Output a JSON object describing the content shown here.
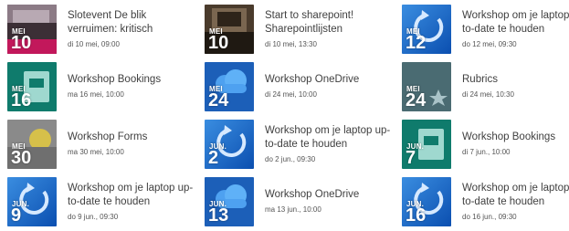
{
  "events": [
    {
      "title": "Slotevent De blik verruimen: kritisch",
      "date": "di 10 mei, 09:00",
      "month": "MEI",
      "day": "10",
      "theme": "photo",
      "icon": "photo-thumbnail"
    },
    {
      "title": "Start to sharepoint! Sharepointlijsten",
      "date": "di 10 mei, 13:30",
      "month": "MEI",
      "day": "10",
      "theme": "photo2",
      "icon": "photo-thumbnail"
    },
    {
      "title": "Workshop om je laptop up-to-date te houden",
      "date": "do 12 mei, 09:30",
      "month": "MEI",
      "day": "12",
      "theme": "blue",
      "icon": "refresh-icon"
    },
    {
      "title": "Workshop Bookings",
      "date": "ma 16 mei, 10:00",
      "month": "MEI",
      "day": "16",
      "theme": "teal",
      "icon": "bookings-icon"
    },
    {
      "title": "Workshop OneDrive",
      "date": "di 24 mei, 10:00",
      "month": "MEI",
      "day": "24",
      "theme": "cloud",
      "icon": "cloud-icon"
    },
    {
      "title": "Rubrics",
      "date": "di 24 mei, 10:30",
      "month": "MEI",
      "day": "24",
      "theme": "grey",
      "icon": "star-icon"
    },
    {
      "title": "Workshop Forms",
      "date": "ma 30 mei, 10:00",
      "month": "MEI",
      "day": "30",
      "theme": "forms",
      "icon": "forms-icon"
    },
    {
      "title": "Workshop om je laptop up-to-date te houden",
      "date": "do 2 jun., 09:30",
      "month": "JUN.",
      "day": "2",
      "theme": "blue",
      "icon": "refresh-icon"
    },
    {
      "title": "Workshop Bookings",
      "date": "di 7 jun., 10:00",
      "month": "JUN.",
      "day": "7",
      "theme": "teal",
      "icon": "bookings-icon"
    },
    {
      "title": "Workshop om je laptop up-to-date te houden",
      "date": "do 9 jun., 09:30",
      "month": "JUN.",
      "day": "9",
      "theme": "blue",
      "icon": "refresh-icon"
    },
    {
      "title": "Workshop OneDrive",
      "date": "ma 13 jun., 10:00",
      "month": "JUN.",
      "day": "13",
      "theme": "cloud",
      "icon": "cloud-icon"
    },
    {
      "title": "Workshop om je laptop up-to-date te houden",
      "date": "do 16 jun., 09:30",
      "month": "JUN.",
      "day": "16",
      "theme": "blue",
      "icon": "refresh-icon"
    }
  ]
}
